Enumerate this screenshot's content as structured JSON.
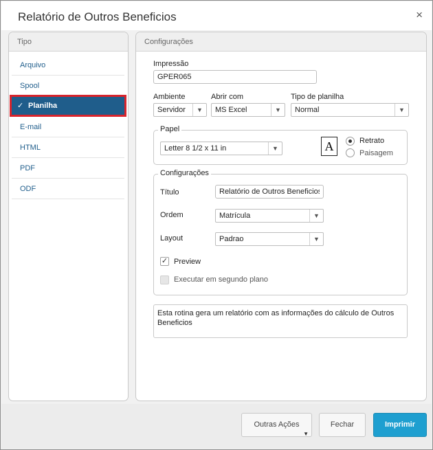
{
  "window": {
    "title": "Relatório de Outros Beneficios"
  },
  "icons": {
    "close": "×",
    "check": "✓",
    "dropdown": "▼",
    "document": "A"
  },
  "left_panel": {
    "header": "Tipo",
    "items": [
      {
        "label": "Arquivo"
      },
      {
        "label": "Spool"
      },
      {
        "label": "Planilha",
        "selected": true
      },
      {
        "label": "E-mail"
      },
      {
        "label": "HTML"
      },
      {
        "label": "PDF"
      },
      {
        "label": "ODF"
      }
    ]
  },
  "right_panel": {
    "header": "Configurações",
    "impressao": {
      "label": "Impressão",
      "value": "GPER065"
    },
    "ambiente": {
      "label": "Ambiente",
      "value": "Servidor"
    },
    "abrir_com": {
      "label": "Abrir com",
      "value": "MS Excel"
    },
    "tipo_planilha": {
      "label": "Tipo de planilha",
      "value": "Normal"
    },
    "papel": {
      "legend": "Papel",
      "size": "Letter 8 1/2 x 11 in",
      "orientation": [
        {
          "label": "Retrato",
          "selected": true
        },
        {
          "label": "Paisagem",
          "selected": false
        }
      ]
    },
    "config": {
      "legend": "Configurações",
      "titulo": {
        "label": "Título",
        "value": "Relatório de Outros Beneficios"
      },
      "ordem": {
        "label": "Ordem",
        "value": "Matrícula"
      },
      "layout": {
        "label": "Layout",
        "value": "Padrao"
      },
      "preview": {
        "label": "Preview",
        "checked": true
      },
      "background": {
        "label": "Executar em segundo plano",
        "checked": false,
        "enabled": false
      }
    },
    "description": "Esta rotina gera um relatório com as informações do cálculo de Outros Beneficios"
  },
  "footer": {
    "outras": "Outras Ações",
    "fechar": "Fechar",
    "imprimir": "Imprimir"
  },
  "colors": {
    "accent": "#1e9fd0",
    "selected_bg": "#1f5d8b",
    "highlight_border": "#d8242c"
  }
}
